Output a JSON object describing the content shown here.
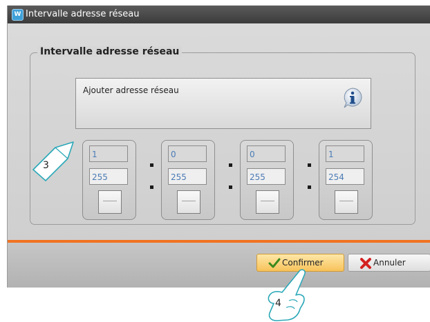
{
  "window": {
    "title": "Intervalle adresse réseau",
    "app_icon": "app-logo-icon"
  },
  "group": {
    "title": "Intervalle adresse réseau",
    "info_text": "Ajouter adresse réseau",
    "info_icon": "info-icon"
  },
  "octets": [
    {
      "start": "1",
      "end": "255"
    },
    {
      "start": "0",
      "end": "255"
    },
    {
      "start": "0",
      "end": "255"
    },
    {
      "start": "1",
      "end": "254"
    }
  ],
  "buttons": {
    "confirm_label": "Confirmer",
    "confirm_icon": "checkmark-icon",
    "cancel_label": "Annuler",
    "cancel_icon": "cross-icon"
  },
  "annotations": {
    "callout_3": "3",
    "callout_4": "4"
  },
  "colors": {
    "accent_line": "#f07320",
    "field_text": "#4b7bb5",
    "confirm_button": "#f8c25a"
  }
}
